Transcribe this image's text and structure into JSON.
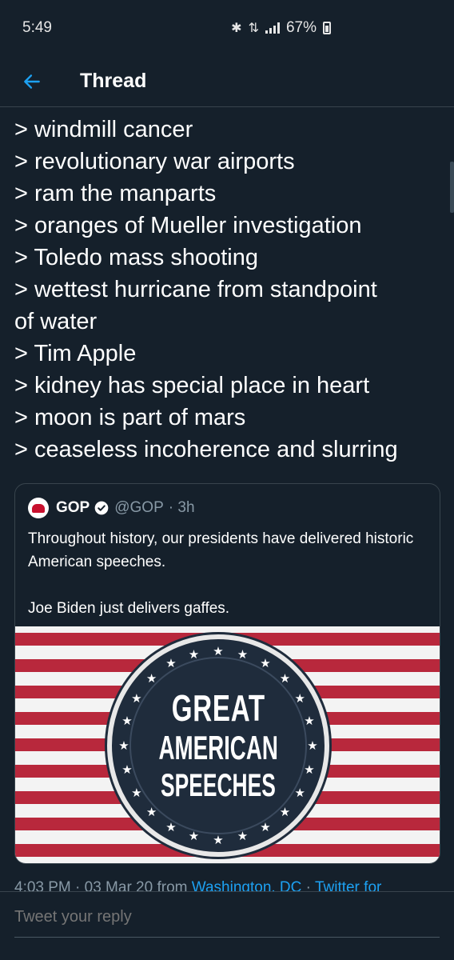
{
  "status_bar": {
    "time": "5:49",
    "battery": "67%",
    "icons": [
      "bluetooth-icon",
      "data-icon",
      "signal-icon",
      "battery-icon"
    ]
  },
  "header": {
    "back_icon": "arrow-left-icon",
    "title": "Thread"
  },
  "tweet": {
    "lines": [
      "> windmill cancer",
      "> revolutionary war airports",
      "> ram the manparts",
      "> oranges of Mueller investigation",
      "> Toledo mass shooting",
      "> wettest hurricane from standpoint",
      "of water",
      "> Tim Apple",
      "> kidney has special place in heart",
      "> moon is part of mars",
      "> ceaseless incoherence and slurring"
    ]
  },
  "quote": {
    "name": "GOP",
    "handle": "@GOP",
    "time": "· 3h",
    "text_1": "Throughout history, our presidents have delivered historic American speeches.",
    "text_2": "Joe Biden just delivers gaffes.",
    "image": {
      "line1": "GREAT",
      "line2": "AMERICAN",
      "line3": "SPEECHES"
    }
  },
  "footer": {
    "timestamp": "4:03 PM · 03 Mar 20 from ",
    "location": "Washington, DC",
    "separator": " · ",
    "source": "Twitter for"
  },
  "reply": {
    "placeholder": "Tweet your reply"
  },
  "colors": {
    "background": "#15202b",
    "accent": "#1da1f2",
    "secondary_text": "#8899a6",
    "border": "#38444d"
  }
}
